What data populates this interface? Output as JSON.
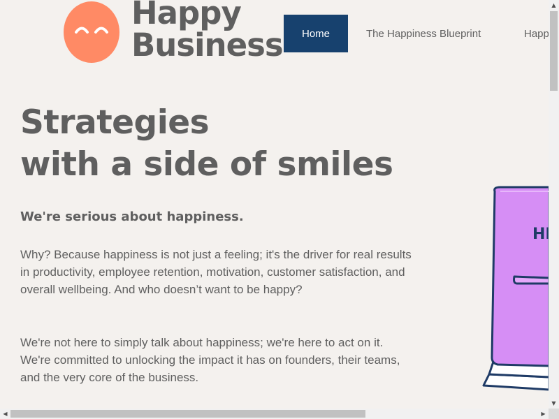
{
  "header": {
    "logo_line1": "Happy",
    "logo_line2": "Business",
    "nav": {
      "home": "Home",
      "blueprint": "The Happiness Blueprint",
      "third": "Happ"
    }
  },
  "hero": {
    "title_line1": "Strategies",
    "title_line2": "with a side of smiles",
    "tagline": "We're serious about happiness.",
    "paragraph1": "Why? Because happiness is not just a feeling; it's the driver for real results in productivity, employee retention, motivation, customer satisfaction, and overall wellbeing. And who doesn’t want to be happy?",
    "paragraph2": "We're not here to simply talk about happiness; we're here to act on it. We're committed to unlocking the impact it has on founders, their teams, and the very core of the business."
  },
  "illustration": {
    "book_text": "HI"
  },
  "colors": {
    "background": "#f4f1ee",
    "text": "#5f5f5f",
    "accent_orange": "#ff8a65",
    "nav_active": "#17416e",
    "book_purple": "#d68ef5",
    "book_outline": "#1f3b66"
  },
  "icons": {
    "logo": "smiley-face-icon",
    "scroll_up": "arrow-up-icon",
    "scroll_down": "arrow-down-icon",
    "scroll_left": "arrow-left-icon",
    "scroll_right": "arrow-right-icon"
  }
}
